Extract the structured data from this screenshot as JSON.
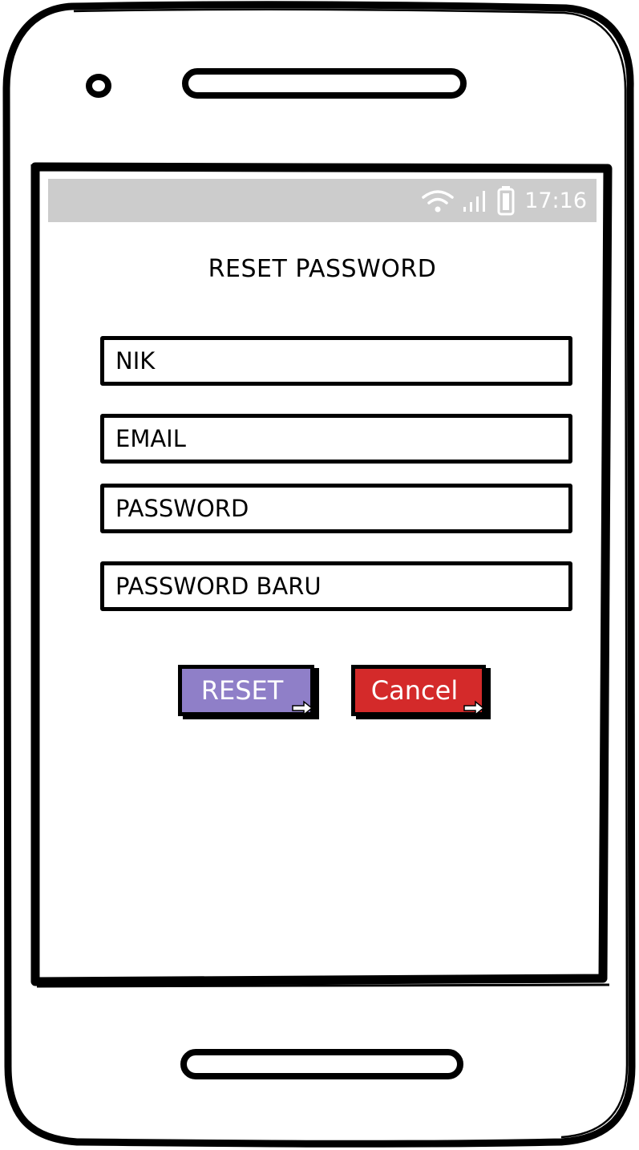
{
  "status_bar": {
    "time": "17:16",
    "icons": [
      "wifi-icon",
      "signal-icon",
      "battery-icon"
    ]
  },
  "form": {
    "title": "RESET PASSWORD",
    "fields": [
      {
        "name": "nik",
        "placeholder": "NIK"
      },
      {
        "name": "email",
        "placeholder": "EMAIL"
      },
      {
        "name": "password",
        "placeholder": "PASSWORD"
      },
      {
        "name": "new-password",
        "placeholder": "PASSWORD BARU"
      }
    ]
  },
  "buttons": {
    "reset_label": "RESET",
    "cancel_label": "Cancel"
  },
  "colors": {
    "status_bar": "#cccccc",
    "reset_button": "#8f7fc8",
    "cancel_button": "#d42a2a"
  }
}
